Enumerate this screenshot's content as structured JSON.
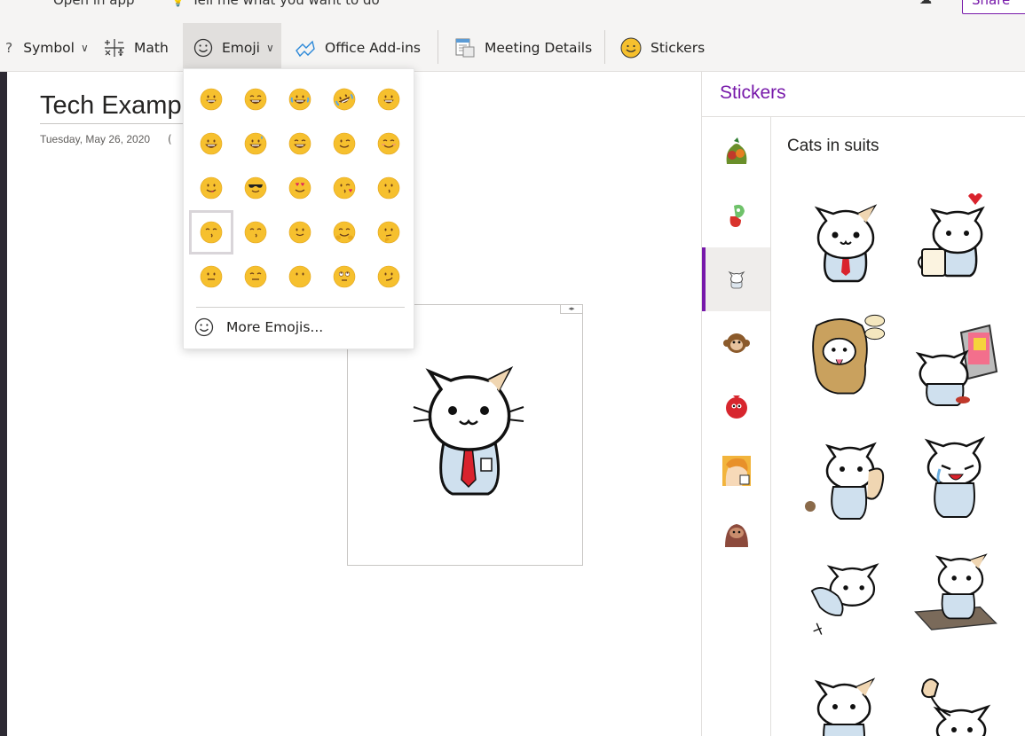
{
  "topbar": {
    "open_in_app": "Open in app",
    "tell_me": "Tell me what you want to do",
    "share": "Share"
  },
  "ribbon": {
    "symbol": "Symbol",
    "math": "Math",
    "emoji": "Emoji",
    "office_addins": "Office Add-ins",
    "meeting_details": "Meeting Details",
    "stickers": "Stickers"
  },
  "page": {
    "title": "Tech Exampl",
    "date": "Tuesday, May 26, 2020",
    "time": "("
  },
  "emoji_menu": {
    "emojis": [
      "😀",
      "😁",
      "😂",
      "🤣",
      "😃",
      "😄",
      "😅",
      "😆",
      "😉",
      "😊",
      "😋",
      "😎",
      "😍",
      "😘",
      "😗",
      "😙",
      "😚",
      "🙂",
      "🤗",
      "🤔",
      "😐",
      "😑",
      "😶",
      "🙄",
      "😏"
    ],
    "selected_index": 15,
    "more_label": "More Emojis..."
  },
  "stickers_pane": {
    "title": "Stickers",
    "active_set": "Cats in suits",
    "categories": [
      "vegetables",
      "monster",
      "cats-in-suits",
      "monkey",
      "red-bird",
      "comic-woman",
      "sloth"
    ],
    "active_category_index": 2
  },
  "colors": {
    "accent": "#7719aa",
    "ribbon_bg": "#f5f4f3",
    "emoji_yellow": "#f6c02e"
  }
}
